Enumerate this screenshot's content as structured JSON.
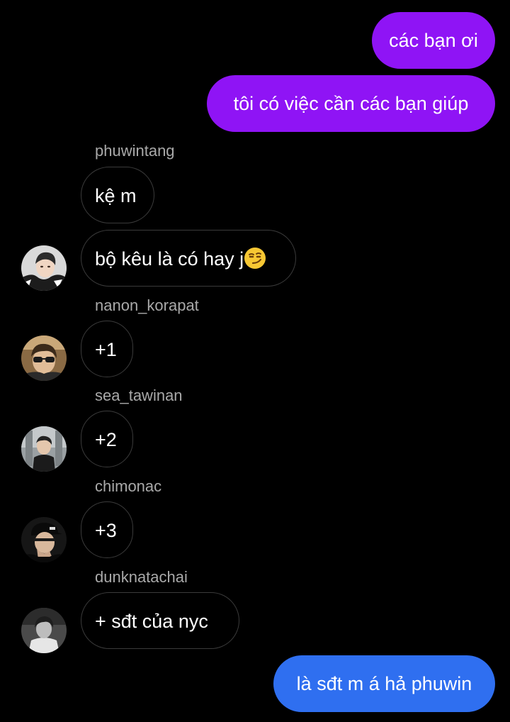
{
  "colors": {
    "outgoing_purple": "#8f14f5",
    "outgoing_blue": "#2f6ff0",
    "incoming_border": "#3b3b3b",
    "sender_name": "#a9a9a9",
    "background": "#000000"
  },
  "messages": [
    {
      "type": "outgoing",
      "text": "các bạn ơi"
    },
    {
      "type": "outgoing",
      "text": "tôi có việc cần các bạn giúp"
    },
    {
      "type": "sender",
      "text": "phuwintang"
    },
    {
      "type": "incoming",
      "text": "kệ m"
    },
    {
      "type": "incoming",
      "text": "bộ kêu là có hay j",
      "emoji": "smirking-face"
    },
    {
      "type": "sender",
      "text": "nanon_korapat"
    },
    {
      "type": "incoming",
      "text": "+1"
    },
    {
      "type": "sender",
      "text": "sea_tawinan"
    },
    {
      "type": "incoming",
      "text": "+2"
    },
    {
      "type": "sender",
      "text": "chimonac"
    },
    {
      "type": "incoming",
      "text": "+3"
    },
    {
      "type": "sender",
      "text": "dunknatachai"
    },
    {
      "type": "incoming",
      "text": "+ sđt của nyc"
    },
    {
      "type": "outgoing",
      "text": "là sđt m á hả phuwin"
    }
  ]
}
